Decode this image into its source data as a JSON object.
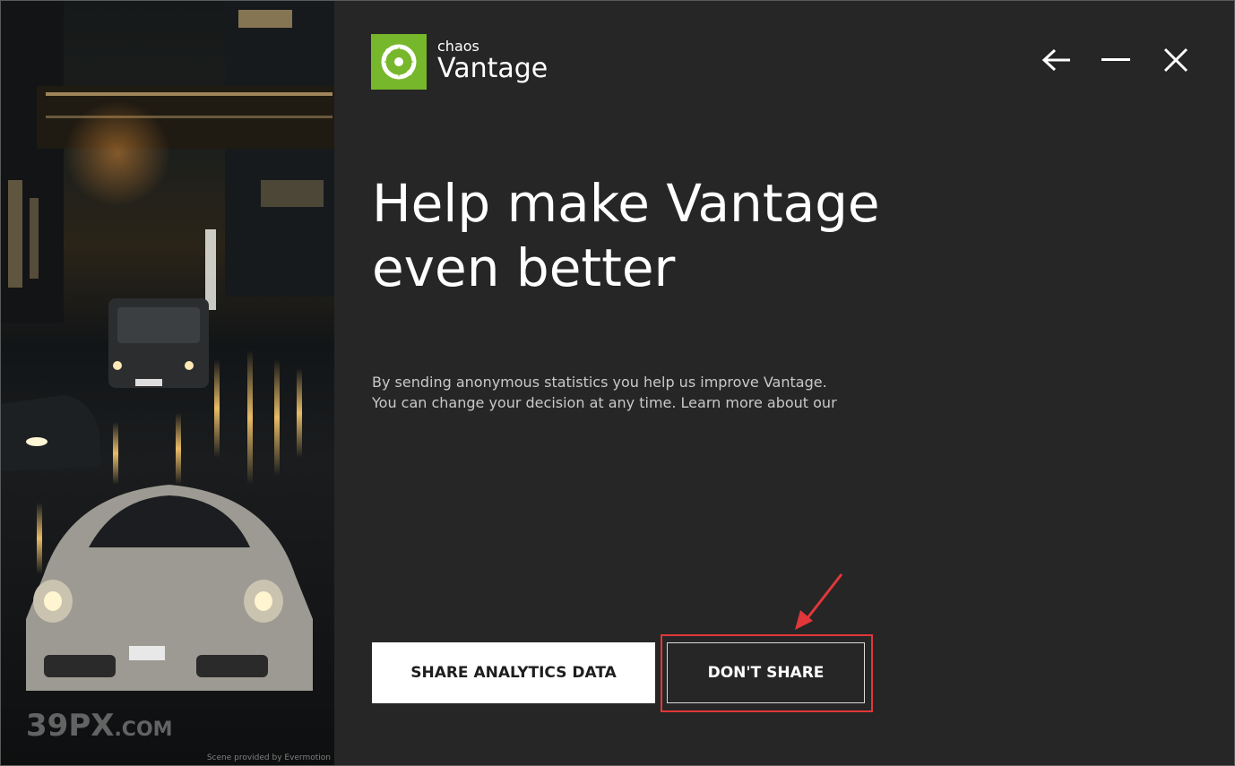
{
  "brand": {
    "company": "chaos",
    "product": "Vantage",
    "logo_color": "#77b72b"
  },
  "window_controls": {
    "back": "arrow-left-icon",
    "minimize": "minimize-icon",
    "close": "close-icon"
  },
  "main": {
    "headline": "Help make Vantage even better",
    "description_line1": "By sending anonymous statistics you help us improve Vantage.",
    "description_line2": "You can change your decision at any time. Learn more about our"
  },
  "buttons": {
    "share_label": "SHARE ANALYTICS DATA",
    "dont_share_label": "DON'T SHARE"
  },
  "scene": {
    "credit": "Scene provided by Evermotion",
    "watermark_big": "39PX",
    "watermark_small": ".COM"
  },
  "colors": {
    "background": "#262626",
    "annotation": "#e2373a",
    "primary_button": "#ffffff"
  }
}
